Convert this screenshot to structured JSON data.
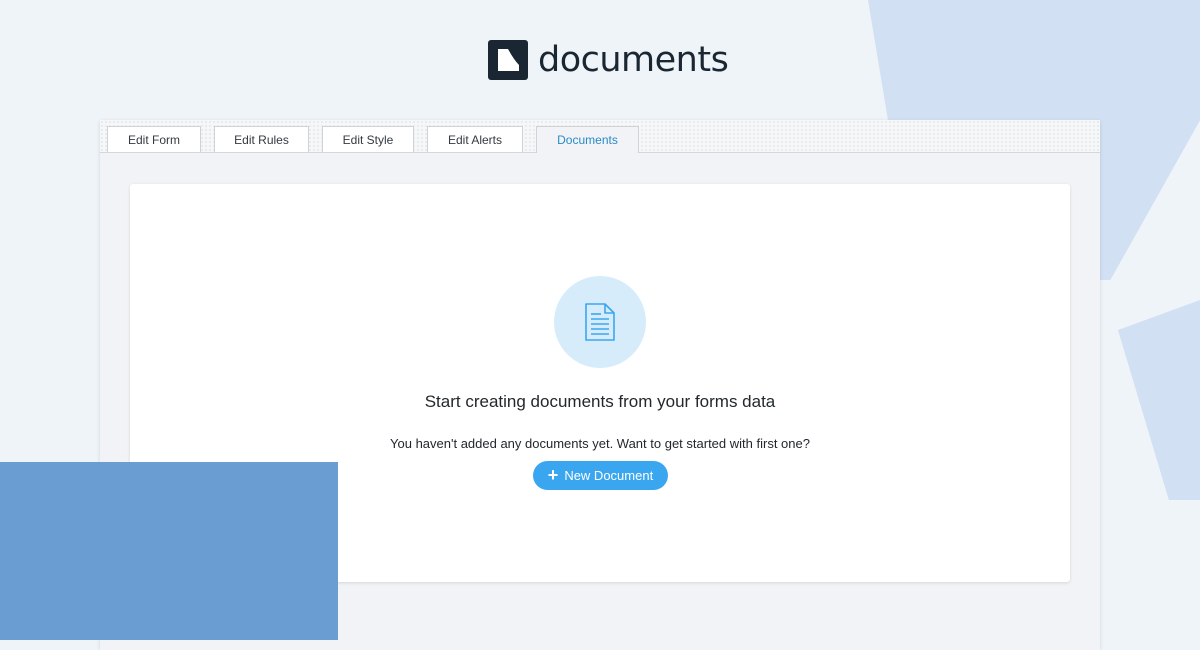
{
  "logo": {
    "text": "documents"
  },
  "tabs": [
    {
      "label": "Edit Form",
      "active": false
    },
    {
      "label": "Edit Rules",
      "active": false
    },
    {
      "label": "Edit Style",
      "active": false
    },
    {
      "label": "Edit Alerts",
      "active": false
    },
    {
      "label": "Documents",
      "active": true
    }
  ],
  "empty_state": {
    "icon": "document-icon",
    "title": "Start creating documents from your forms data",
    "description": "You haven't added any documents yet. Want to get started with first one?",
    "button_label": "New Document",
    "button_icon": "plus-icon"
  },
  "colors": {
    "accent": "#3aa6f0",
    "active_tab_text": "#2a8bc6",
    "logo_dark": "#1a2733",
    "icon_circle": "#d6ecfb",
    "shape_blue": "#6a9ed3",
    "shape_light": "#d2e0f3"
  }
}
